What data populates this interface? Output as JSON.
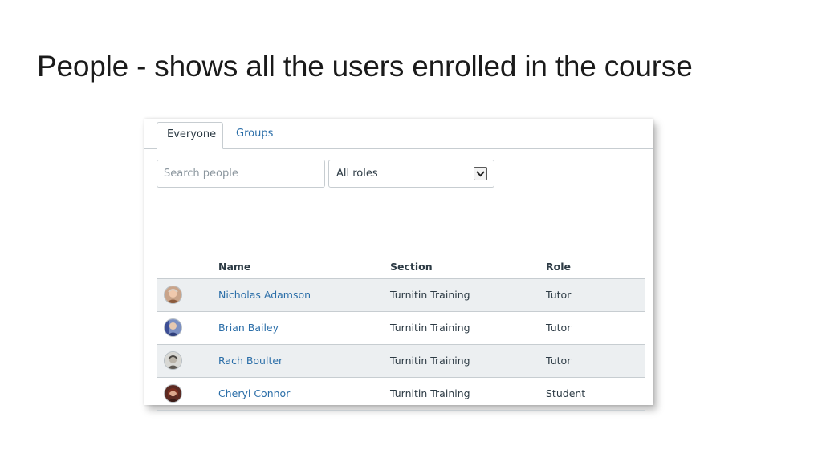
{
  "slide": {
    "title": "People - shows all the users enrolled in the course"
  },
  "tabs": [
    {
      "label": "Everyone",
      "active": true
    },
    {
      "label": "Groups",
      "active": false
    }
  ],
  "filters": {
    "search_placeholder": "Search people",
    "role_select": "All roles",
    "role_select_icon": "chevron-down-icon"
  },
  "table": {
    "headers": {
      "name": "Name",
      "section": "Section",
      "role": "Role"
    },
    "rows": [
      {
        "name": "Nicholas Adamson",
        "section": "Turnitin Training",
        "role": "Tutor"
      },
      {
        "name": "Brian Bailey",
        "section": "Turnitin Training",
        "role": "Tutor"
      },
      {
        "name": "Rach Boulter",
        "section": "Turnitin Training",
        "role": "Tutor"
      },
      {
        "name": "Cheryl Connor",
        "section": "Turnitin Training",
        "role": "Student"
      }
    ]
  },
  "colors": {
    "link": "#2b6ea8",
    "text": "#2d3b45",
    "row_shade": "#eceff1",
    "border": "#c7cdd1"
  }
}
